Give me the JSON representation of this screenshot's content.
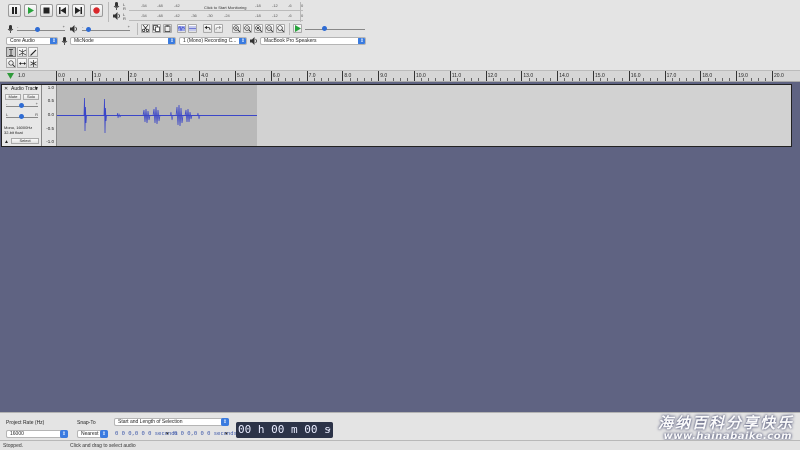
{
  "meters": {
    "record_ticks": [
      "-54",
      "-48",
      "-42",
      "-18",
      "-12",
      "-6",
      "0"
    ],
    "playback_ticks": [
      "-54",
      "-48",
      "-42",
      "-36",
      "-30",
      "-24",
      "-18",
      "-12",
      "-6",
      "0"
    ],
    "monitor_label": "Click to Start Monitoring",
    "channel_left": "L",
    "channel_right": "R"
  },
  "mixer": {
    "record_min": "-",
    "record_max": "+",
    "playback_min": "-",
    "playback_max": "+"
  },
  "devices": {
    "host": "Core Audio",
    "recording_device": "MicNode",
    "channels": "1 (Mono) Recording C...",
    "playback_device": "MacBook Pro Speakers"
  },
  "timeline": {
    "labels": [
      "0.0",
      "1.0",
      "2.0",
      "3.0",
      "4.0",
      "5.0",
      "6.0",
      "7.0",
      "8.0",
      "9.0",
      "10.0",
      "11.0",
      "12.0",
      "13.0",
      "14.0",
      "15.0",
      "16.0",
      "17.0",
      "18.0",
      "19.0",
      "20.0"
    ],
    "pre_label": "1.0"
  },
  "track": {
    "name": "Audio Track",
    "mute_label": "Mute",
    "solo_label": "Solo",
    "gain_min": "-",
    "gain_max": "+",
    "pan_left": "L",
    "pan_right": "R",
    "info_line1": "Mono, 16000Hz",
    "info_line2": "32-bit float",
    "select_label": "Select",
    "vruler": [
      "1.0",
      "0.5",
      "0.0",
      "-0.5",
      "-1.0"
    ]
  },
  "selection_toolbar": {
    "rate_label": "Project Rate (Hz)",
    "rate_value": "16000",
    "snap_label": "Snap-To",
    "snap_value": "Nearest",
    "range_label": "Start and Length of Selection",
    "start_time": "0 0 0,0 0 0 seconds",
    "length_time": "0 0 0,0 0 0 seconds",
    "position": "00 h 00 m 00 s"
  },
  "status": {
    "state": "Stopped.",
    "hint": "Click and drag to select audio"
  },
  "watermark": {
    "cn": "海纳百科分享快乐",
    "en": "www.hainabaike.com"
  },
  "colors": {
    "waveform": "#3b46c8",
    "track_bg": "#5f6382",
    "accent": "#3a7be0",
    "record": "#d8262a",
    "play": "#27a33b"
  }
}
